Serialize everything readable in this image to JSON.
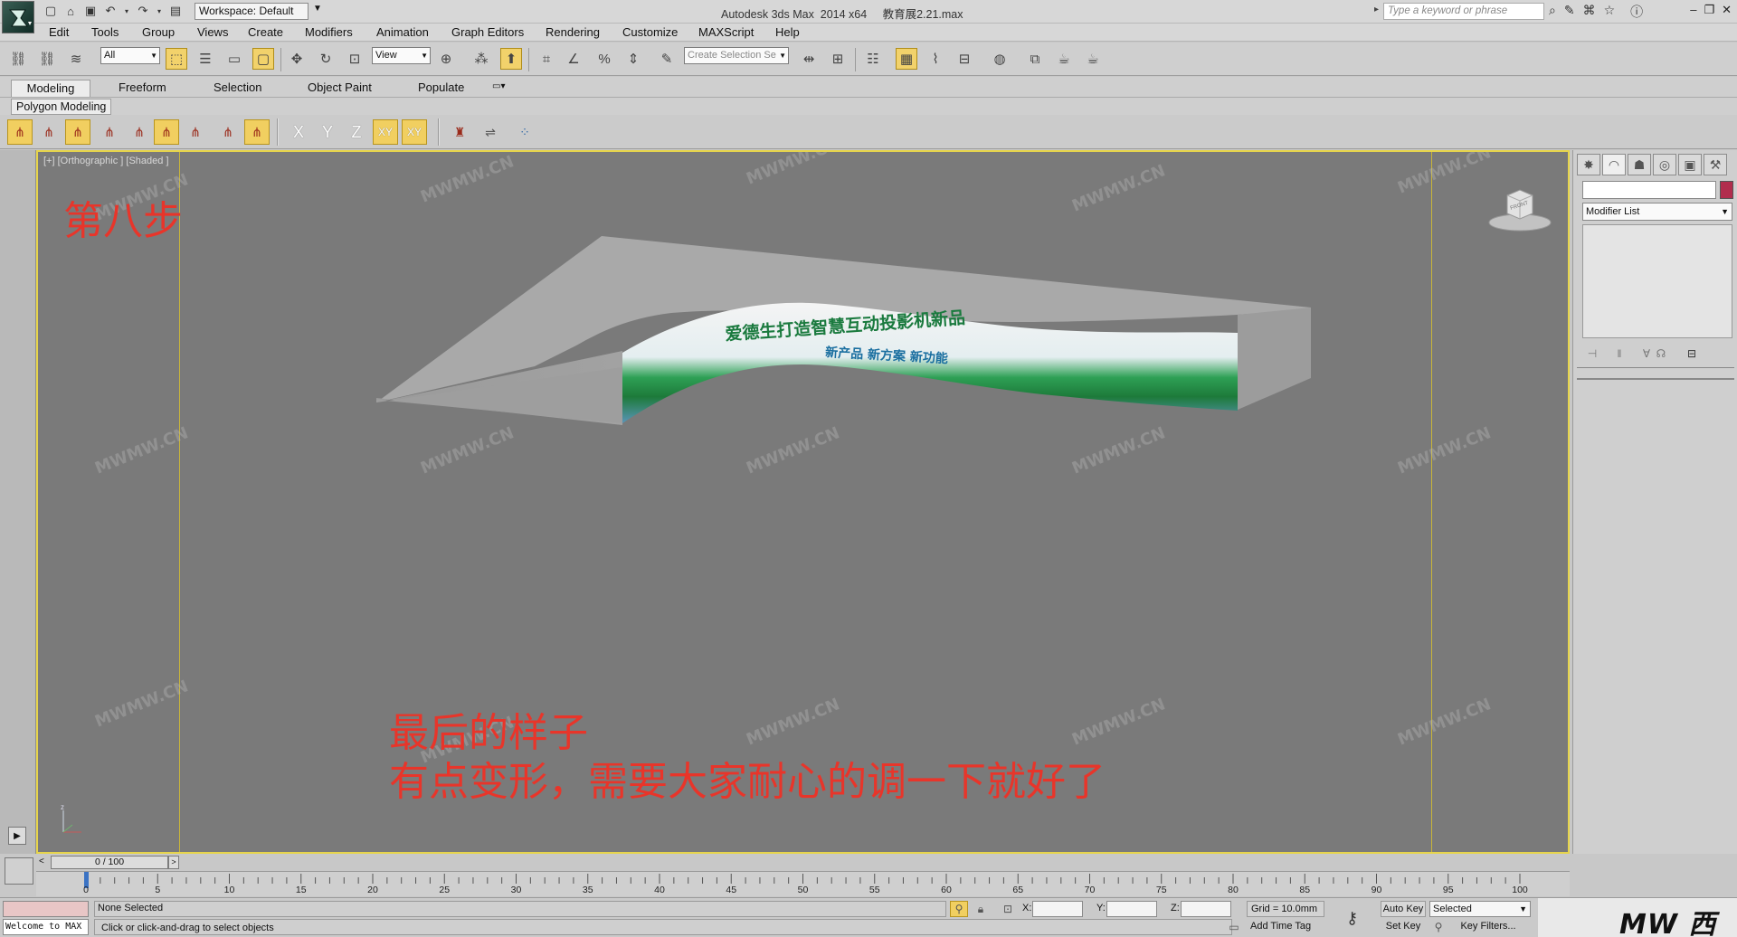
{
  "titlebar": {
    "workspace_label": "Workspace: Default",
    "window_title": "Autodesk 3ds Max  2014 x64     教育展2.21.max",
    "search_placeholder": "Type a keyword or phrase"
  },
  "menu": [
    "Edit",
    "Tools",
    "Group",
    "Views",
    "Create",
    "Modifiers",
    "Animation",
    "Graph Editors",
    "Rendering",
    "Customize",
    "MAXScript",
    "Help"
  ],
  "toolbar": {
    "selection_filter": "All",
    "ref_coord": "View",
    "named_selection_placeholder": "Create Selection Se"
  },
  "ribbon": {
    "tabs": [
      "Modeling",
      "Freeform",
      "Selection",
      "Object Paint",
      "Populate"
    ],
    "active_tab": "Modeling",
    "panel_label": "Polygon Modeling",
    "axis_letters": [
      "X",
      "Y",
      "Z",
      "XY",
      "XY"
    ]
  },
  "viewport": {
    "label": "[+] [Orthographic ] [Shaded ]",
    "step_label": "第八步",
    "caption_line1": "最后的样子",
    "caption_line2": "有点变形，需要大家耐心的调一下就好了",
    "watermark_text": "MWMW.CN",
    "banner_line1": "爱德生打造智慧互动投影机新品",
    "banner_line2": "新产品  新方案  新功能",
    "viewcube_text": "FRONT"
  },
  "command_panel": {
    "modifier_list": "Modifier List",
    "color_swatch": "#b12d4d"
  },
  "timeline": {
    "frame_readout": "0 / 100",
    "ticks": [
      0,
      5,
      10,
      15,
      20,
      25,
      30,
      35,
      40,
      45,
      50,
      55,
      60,
      65,
      70,
      75,
      80,
      85,
      90,
      95,
      100
    ]
  },
  "status": {
    "listener_text": "Welcome to MAX",
    "selection": "None Selected",
    "prompt": "Click or click-and-drag to select objects",
    "x_label": "X:",
    "y_label": "Y:",
    "z_label": "Z:",
    "grid": "Grid = 10.0mm",
    "add_time_tag": "Add Time Tag",
    "auto_key": "Auto Key",
    "set_key": "Set Key",
    "key_mode": "Selected",
    "key_filters": "Key Filters...",
    "brand": "MW 西西瓦特"
  },
  "colors": {
    "viewport_bg": "#7a7a7a",
    "viewport_border": "#e6d44c",
    "caption_red": "#e8352a",
    "active_tool": "#f2d26b"
  }
}
